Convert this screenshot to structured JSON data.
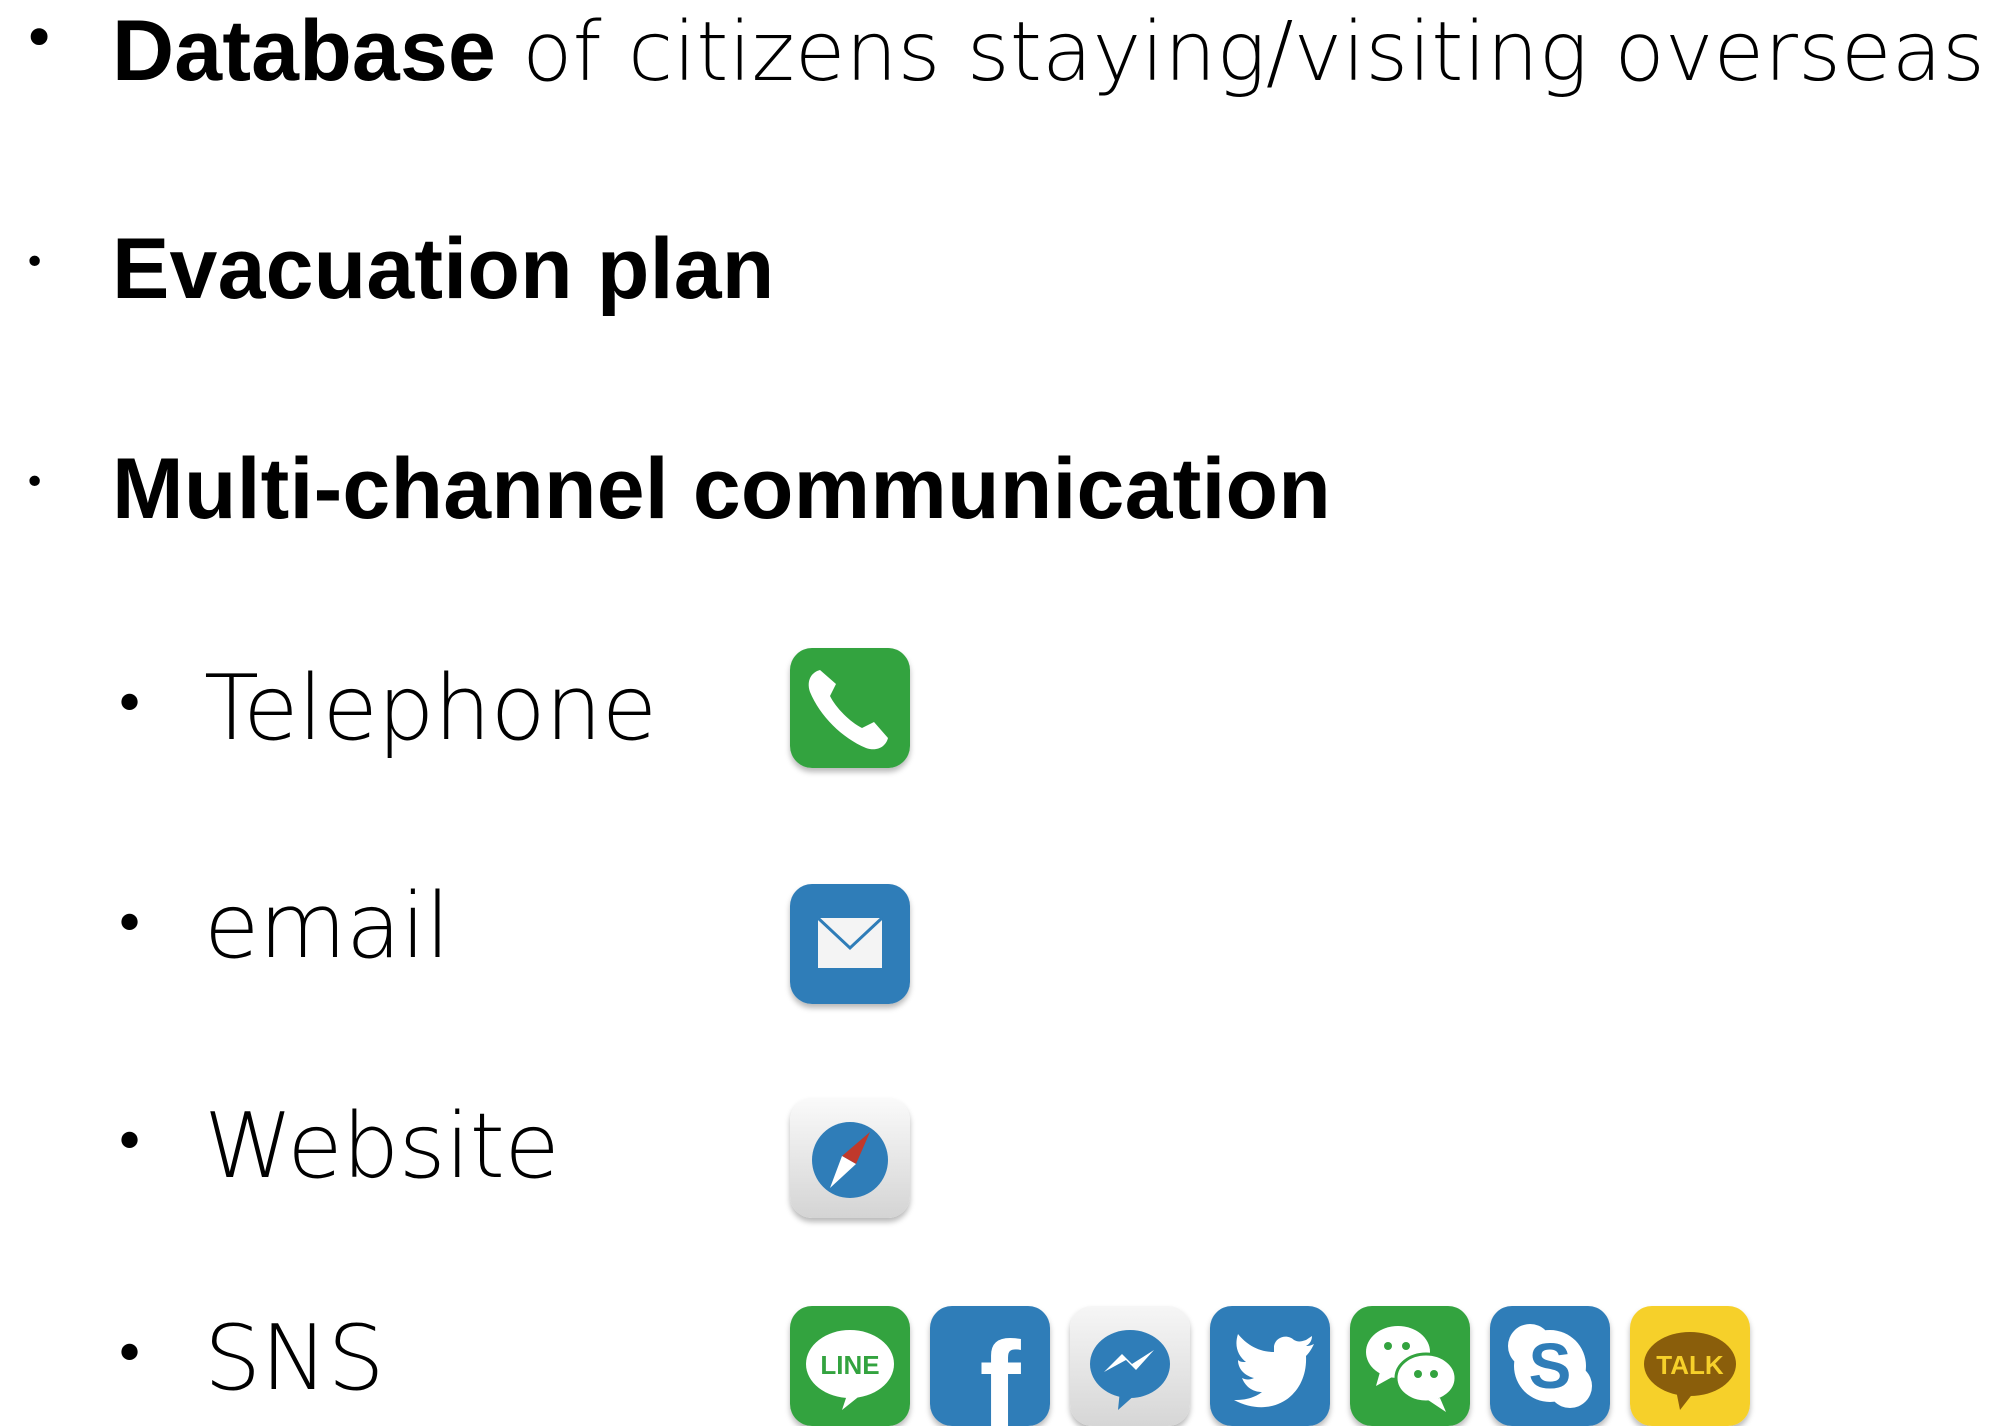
{
  "bullets": {
    "database": {
      "strong": "Database",
      "rest": " of citizens staying/visiting overseas"
    },
    "evacuation": {
      "strong": "Evacuation plan"
    },
    "multichannel": {
      "strong": "Multi-channel communication"
    }
  },
  "channels": [
    {
      "label": "Telephone",
      "icon": "phone-icon"
    },
    {
      "label": "email",
      "icon": "mail-icon"
    },
    {
      "label": "Website",
      "icon": "compass-icon"
    },
    {
      "label": "SNS",
      "icons": [
        "line-icon",
        "facebook-icon",
        "messenger-icon",
        "twitter-icon",
        "wechat-icon",
        "skype-icon",
        "kakaotalk-icon"
      ]
    }
  ],
  "icon_text": {
    "line": "LINE",
    "facebook": "f",
    "skype": "S",
    "kakao": "TALK"
  },
  "colors": {
    "green": "#33a33f",
    "blue": "#2f7db8",
    "yellow": "#f6d02a",
    "gray": "#e6e6e6",
    "red": "#c0392b"
  }
}
